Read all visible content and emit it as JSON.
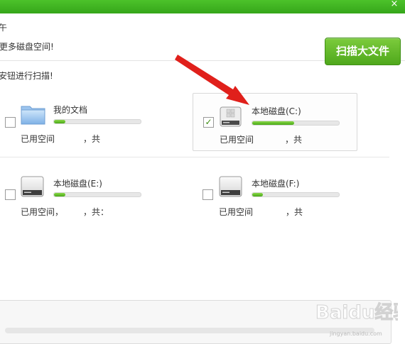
{
  "titlebar": {
    "close_glyph": "×"
  },
  "header": {
    "line1": "午",
    "line2": "更多磁盘空间!",
    "scan_big_files_label": "扫描大文件"
  },
  "instruction": "安钮进行扫描!",
  "drives": [
    {
      "name": "我的文档",
      "checked": false,
      "used_label": "已用空间",
      "sep": "，共",
      "icon": "folder-icon",
      "usage_fraction": 0.13
    },
    {
      "name": "本地磁盘(C:)",
      "checked": true,
      "used_label": "已用空间",
      "sep": "，共",
      "icon": "windows-drive-icon",
      "usage_fraction": 0.48
    },
    {
      "name": "本地磁盘(E:)",
      "checked": false,
      "used_label": "已用空间，",
      "sep": "，共：",
      "icon": "hard-drive-icon",
      "usage_fraction": 0.13
    },
    {
      "name": "本地磁盘(F:)",
      "checked": false,
      "used_label": "已用空间",
      "sep": "，共",
      "icon": "hard-drive-icon",
      "usage_fraction": 0.12
    }
  ],
  "watermark": {
    "text": "jingyan.baidu.com",
    "logo_text": "Baidu经验"
  },
  "colors": {
    "accent_green": "#4fa81c",
    "titlebar_green": "#3db222",
    "arrow_red": "#e0201b"
  }
}
